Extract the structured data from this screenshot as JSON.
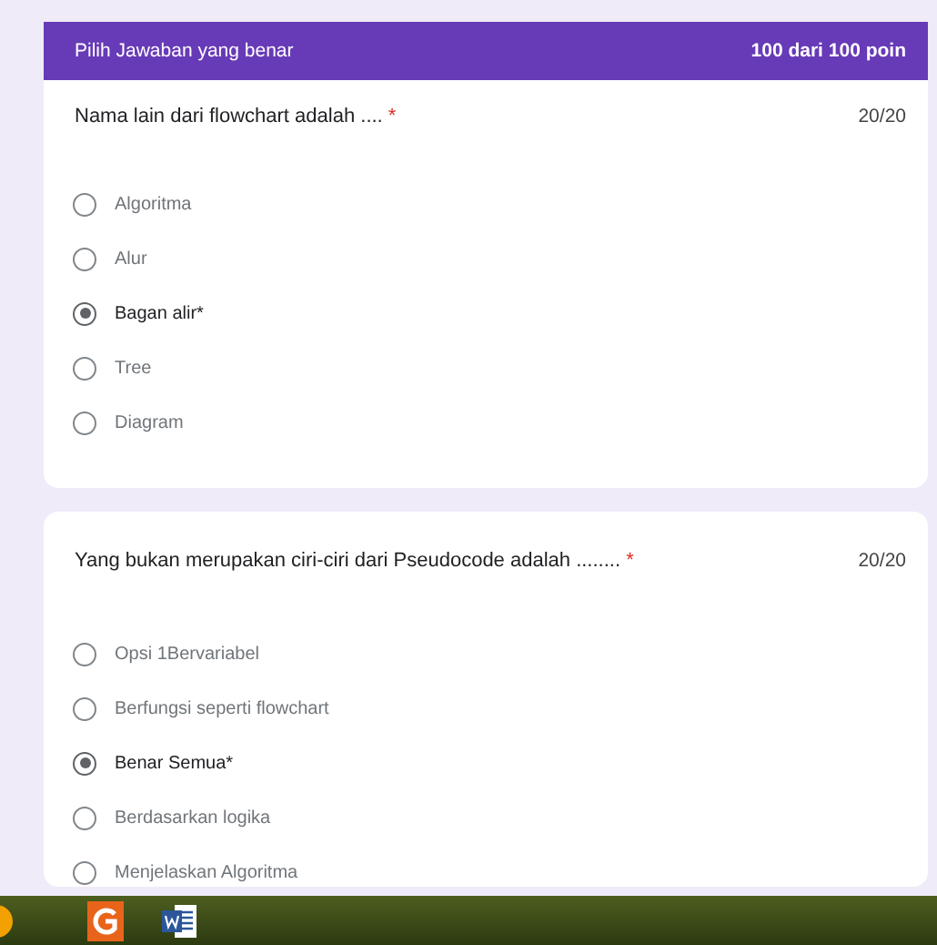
{
  "header": {
    "title": "Pilih Jawaban yang benar",
    "score": "100 dari 100 poin"
  },
  "questions": [
    {
      "text": "Nama lain dari flowchart adalah ....",
      "required_mark": "*",
      "points": "20/20",
      "options": [
        {
          "label": "Algoritma",
          "selected": false
        },
        {
          "label": "Alur",
          "selected": false
        },
        {
          "label": "Bagan alir*",
          "selected": true
        },
        {
          "label": "Tree",
          "selected": false
        },
        {
          "label": "Diagram",
          "selected": false
        }
      ]
    },
    {
      "text": "Yang bukan merupakan ciri-ciri dari Pseudocode adalah ........",
      "required_mark": "*",
      "points": "20/20",
      "options": [
        {
          "label": "Opsi 1Bervariabel",
          "selected": false
        },
        {
          "label": "Berfungsi seperti flowchart",
          "selected": false
        },
        {
          "label": "Benar Semua*",
          "selected": true
        },
        {
          "label": "Berdasarkan logika",
          "selected": false
        },
        {
          "label": "Menjelaskan Algoritma",
          "selected": false
        }
      ]
    }
  ]
}
